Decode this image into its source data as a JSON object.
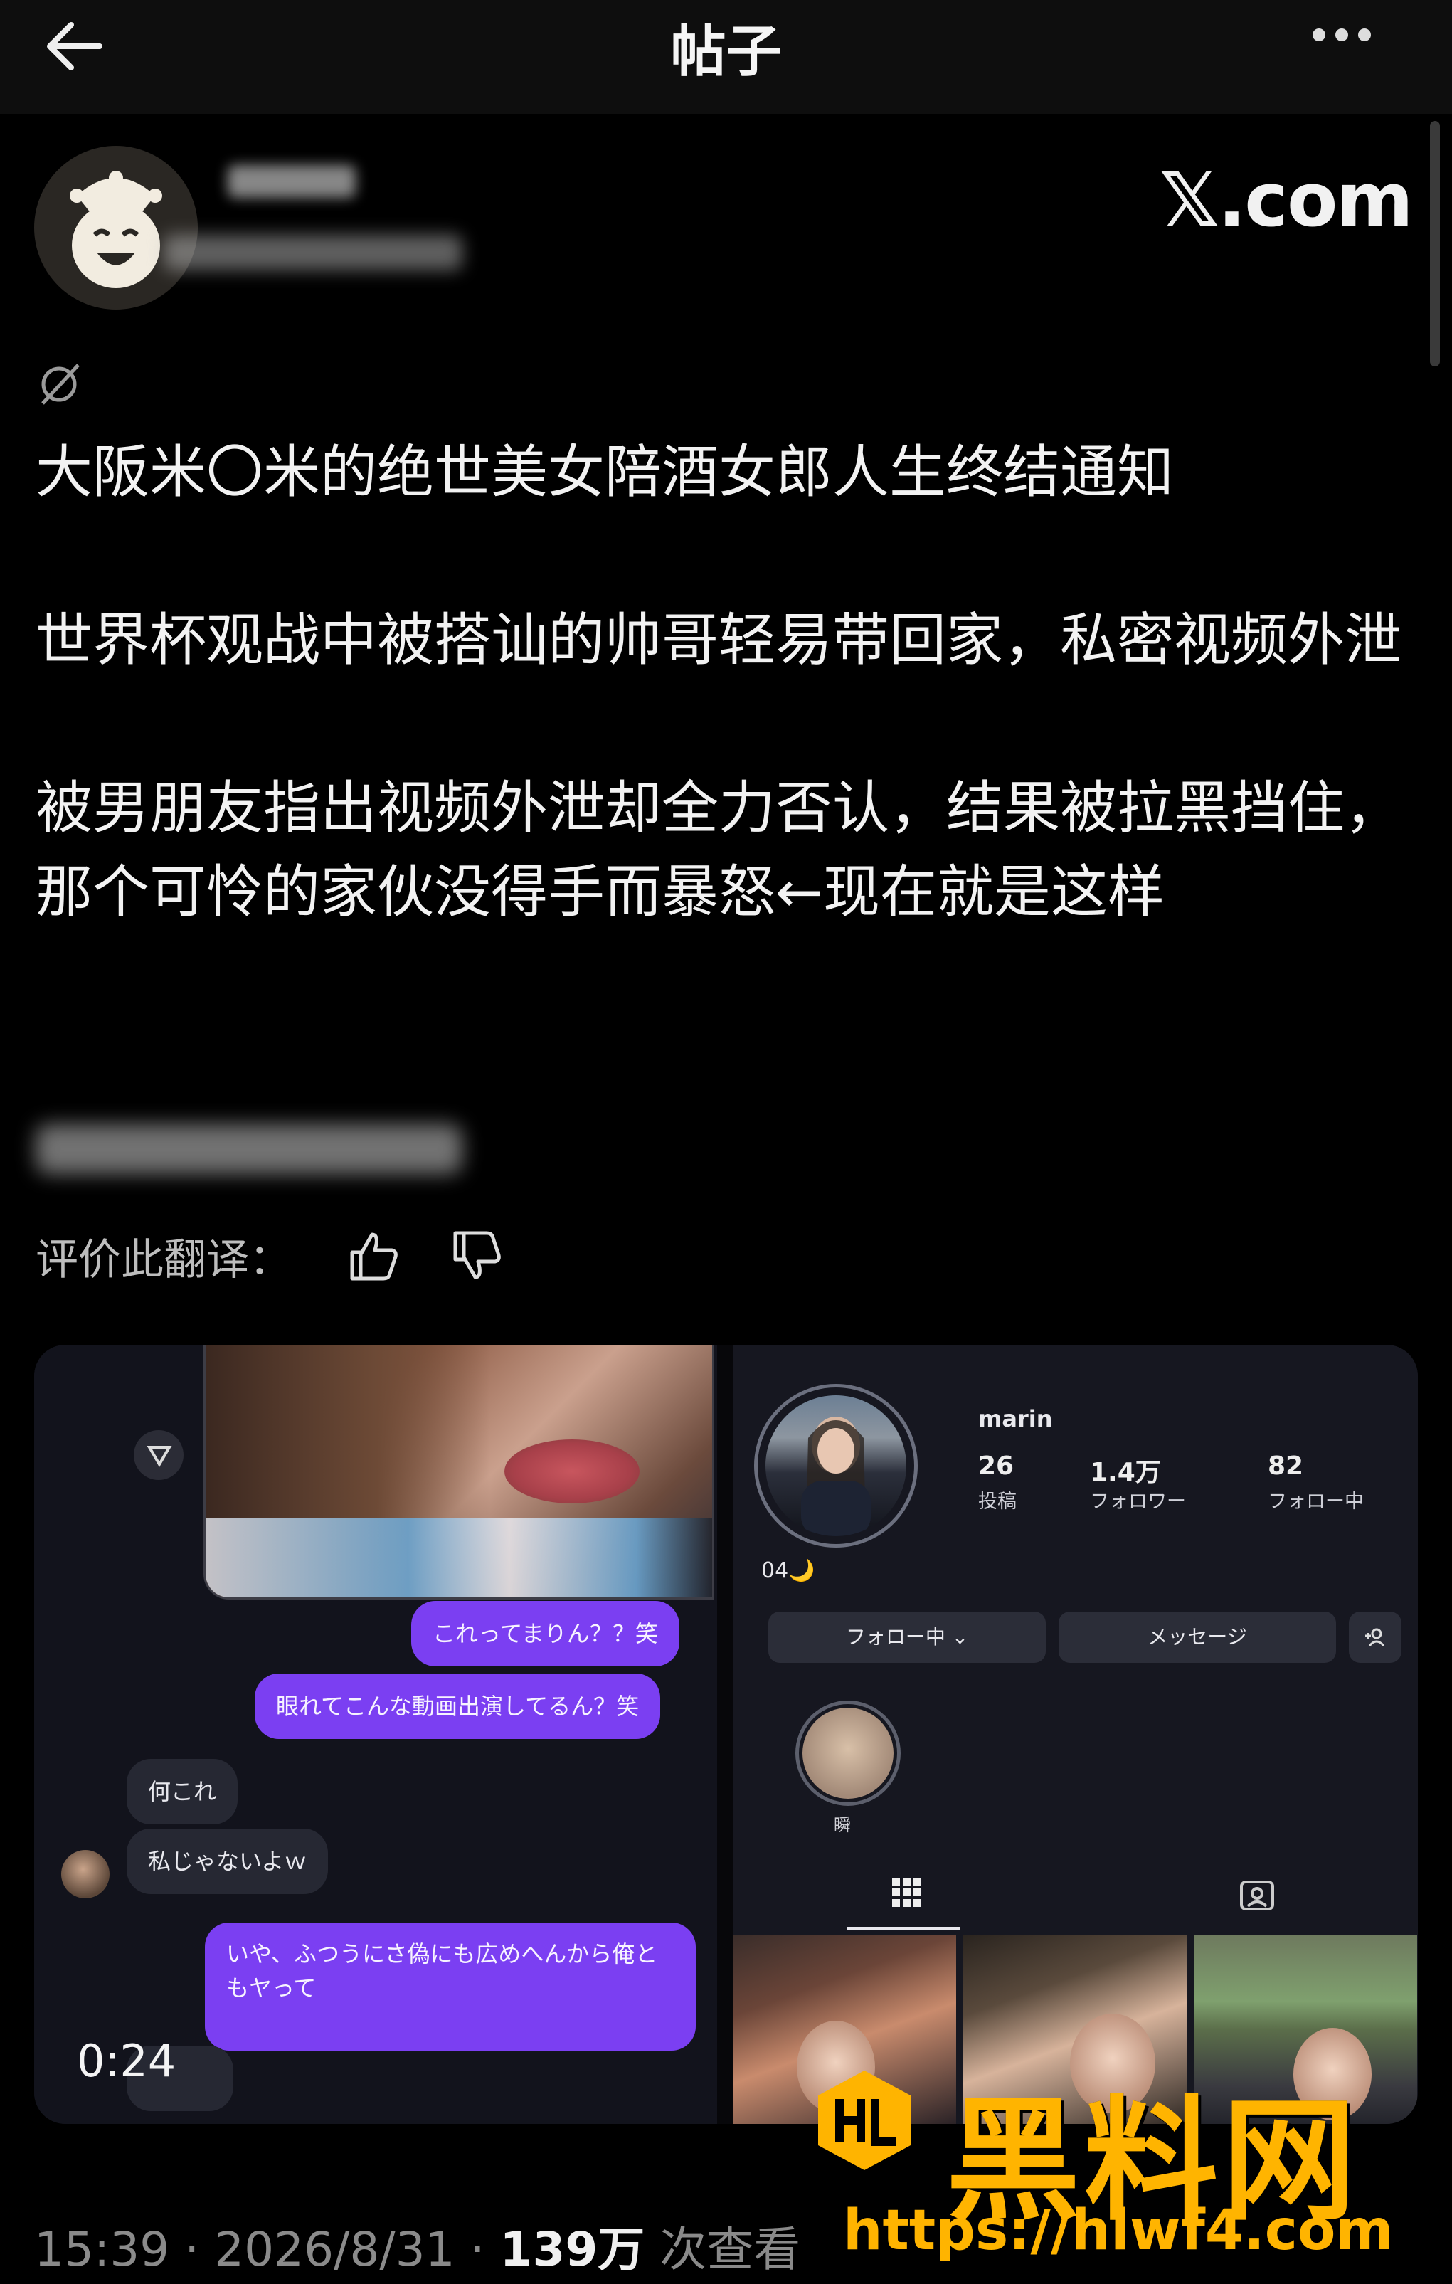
{
  "header": {
    "title": "帖子"
  },
  "post": {
    "source": "𝕏.com",
    "paragraphs": [
      "大阪米〇米的绝世美女陪酒女郎人生终结通知",
      "世界杯观战中被搭讪的帅哥轻易带回家，私密视频外泄",
      "被男朋友指出视频外泄却全力否认，结果被拉黑挡住，那个可怜的家伙没得手而暴怒←现在就是这样"
    ],
    "rate_label": "评价此翻译："
  },
  "media": {
    "chat": {
      "messages": [
        {
          "text": "これってまりん？？笑",
          "dir": "out"
        },
        {
          "text": "眼れてこんな動画出演してるん？笑",
          "dir": "out"
        },
        {
          "text": "何これ",
          "dir": "in"
        },
        {
          "text": "私じゃないよｗ",
          "dir": "in"
        },
        {
          "text": "いや、ふつうにさ偽にも広めへんから俺ともヤって",
          "dir": "out"
        }
      ],
      "duration": "0:24"
    },
    "profile": {
      "username": "marin",
      "stats": [
        {
          "value": "26",
          "label": "投稿"
        },
        {
          "value": "1.4万",
          "label": "フォロワー"
        },
        {
          "value": "82",
          "label": "フォロー中"
        }
      ],
      "bio": "04🌙",
      "follow_label": "フォロー中 ⌄",
      "message_label": "メッセージ",
      "highlight_label": "瞬"
    }
  },
  "footer": {
    "time": "15:39",
    "date": "2026/8/31",
    "views": "139万",
    "views_label": "次查看",
    "sep": "·"
  },
  "watermark": {
    "brand": "黑料网",
    "url": "https://hlwf4.com"
  },
  "colors": {
    "accent_purple": "#7b3ff2",
    "watermark": "#ffb400",
    "background": "#000000"
  }
}
